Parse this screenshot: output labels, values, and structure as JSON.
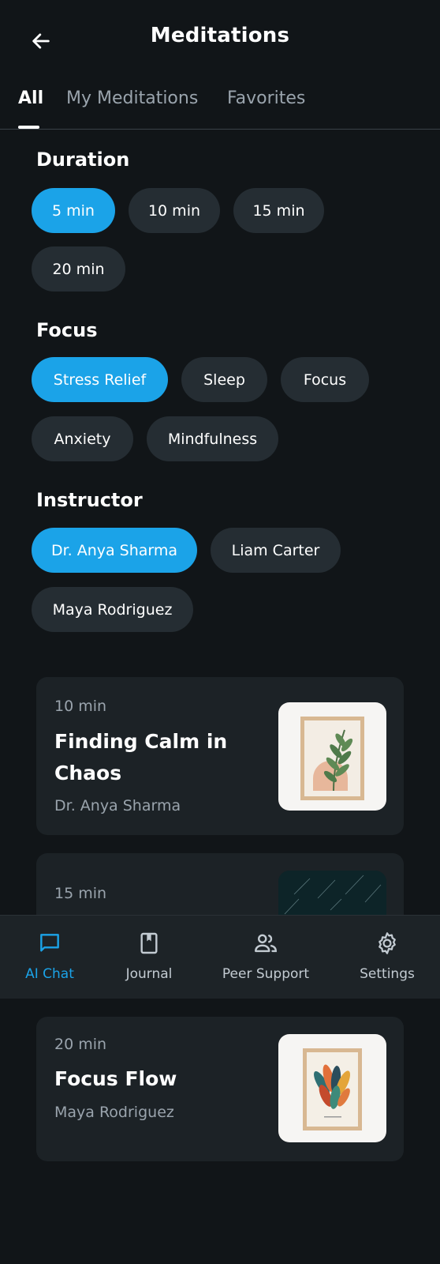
{
  "header": {
    "title": "Meditations",
    "back_icon": "arrow-left-icon"
  },
  "tabs": [
    {
      "label": "All",
      "active": true
    },
    {
      "label": "My Meditations",
      "active": false
    },
    {
      "label": "Favorites",
      "active": false
    }
  ],
  "filters": {
    "duration": {
      "title": "Duration",
      "options": [
        "5 min",
        "10 min",
        "15 min",
        "20 min"
      ],
      "selected": "5 min"
    },
    "focus": {
      "title": "Focus",
      "options": [
        "Stress Relief",
        "Sleep",
        "Focus",
        "Anxiety",
        "Mindfulness"
      ],
      "selected": "Stress Relief"
    },
    "instructor": {
      "title": "Instructor",
      "options": [
        "Dr. Anya Sharma",
        "Liam Carter",
        "Maya Rodriguez"
      ],
      "selected": "Dr. Anya Sharma"
    }
  },
  "meditations": [
    {
      "duration": "10 min",
      "title_line1": "Finding Calm in",
      "title_line2": "Chaos",
      "instructor": "Dr. Anya Sharma"
    },
    {
      "duration": "15 min"
    },
    {
      "duration": "20 min",
      "title_line1": "Focus Flow",
      "instructor": "Maya Rodriguez"
    }
  ],
  "bottom_nav": [
    {
      "label": "AI Chat",
      "icon": "chat-icon",
      "active": true
    },
    {
      "label": "Journal",
      "icon": "book-icon",
      "active": false
    },
    {
      "label": "Peer Support",
      "icon": "people-icon",
      "active": false
    },
    {
      "label": "Settings",
      "icon": "gear-icon",
      "active": false
    }
  ],
  "colors": {
    "accent": "#1ba3e8",
    "background": "#111518",
    "chip": "#252d33",
    "card": "#1c2226",
    "nav": "#1d2327"
  }
}
